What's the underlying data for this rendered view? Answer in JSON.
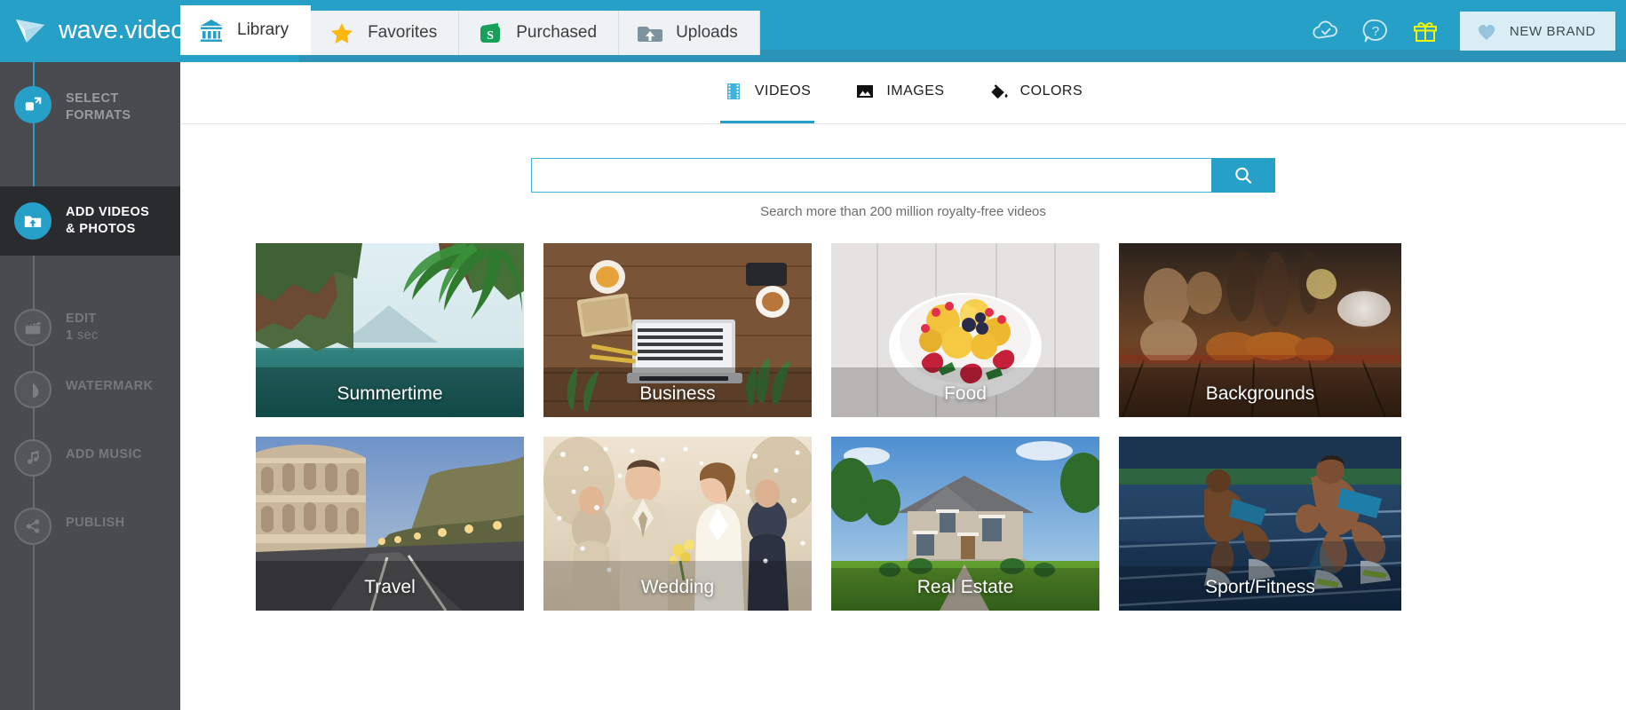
{
  "brand": {
    "name": "wave.video",
    "logo_icon": "wave-play-logo"
  },
  "header": {
    "tabs": [
      {
        "label": "Library",
        "icon": "bank-library-icon",
        "active": true
      },
      {
        "label": "Favorites",
        "icon": "star-icon",
        "active": false
      },
      {
        "label": "Purchased",
        "icon": "money-bag-icon",
        "active": false
      },
      {
        "label": "Uploads",
        "icon": "folder-upload-icon",
        "active": false
      }
    ],
    "actions": [
      {
        "name": "cloud-saved-icon",
        "title": "Saved"
      },
      {
        "name": "help-icon",
        "title": "Help"
      },
      {
        "name": "gift-icon",
        "title": "Gift"
      }
    ],
    "new_brand": {
      "label": "NEW BRAND",
      "icon": "heart-brand-icon"
    },
    "accent_color": "#27a0c8",
    "underline_color": "#2b93b7"
  },
  "sidebar": {
    "steps": [
      {
        "label": "SELECT\nFORMATS",
        "line1": "SELECT",
        "line2": "FORMATS",
        "icon": "formats-icon",
        "state": "done"
      },
      {
        "label": "ADD VIDEOS & PHOTOS",
        "line1": "ADD VIDEOS",
        "line2": "& PHOTOS",
        "icon": "add-media-icon",
        "state": "current"
      },
      {
        "label": "EDIT",
        "line1": "EDIT",
        "line2": "1 sec",
        "sub_value": "1",
        "sub_unit": "sec",
        "icon": "clapperboard-icon",
        "state": "todo"
      },
      {
        "label": "WATERMARK",
        "line1": "WATERMARK",
        "line2": "",
        "icon": "watermark-drop-icon",
        "state": "todo"
      },
      {
        "label": "ADD MUSIC",
        "line1": "ADD MUSIC",
        "line2": "",
        "icon": "music-note-icon",
        "state": "todo"
      },
      {
        "label": "PUBLISH",
        "line1": "PUBLISH",
        "line2": "",
        "icon": "share-icon",
        "state": "todo"
      }
    ]
  },
  "main": {
    "subtabs": [
      {
        "label": "VIDEOS",
        "icon": "film-strip-icon",
        "active": true
      },
      {
        "label": "IMAGES",
        "icon": "photo-icon",
        "active": false
      },
      {
        "label": "COLORS",
        "icon": "paint-bucket-icon",
        "active": false
      }
    ],
    "search": {
      "value": "",
      "placeholder": "",
      "button_icon": "search-icon",
      "hint": "Search more than 200 million royalty-free videos"
    },
    "categories": [
      {
        "label": "Summertime",
        "art": "tropical-lagoon"
      },
      {
        "label": "Business",
        "art": "desk-laptop"
      },
      {
        "label": "Food",
        "art": "fruit-bowl"
      },
      {
        "label": "Backgrounds",
        "art": "blurred-bokeh-wood"
      },
      {
        "label": "Travel",
        "art": "colosseum-road"
      },
      {
        "label": "Wedding",
        "art": "bride-groom-confetti"
      },
      {
        "label": "Real Estate",
        "art": "suburban-house"
      },
      {
        "label": "Sport/Fitness",
        "art": "runners-track"
      }
    ]
  }
}
